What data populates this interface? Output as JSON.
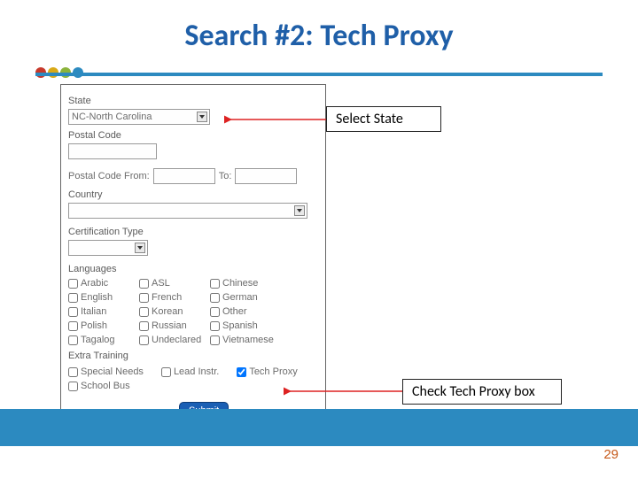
{
  "title": "Search #2: Tech Proxy",
  "dot_colors": [
    "#c7392b",
    "#d9a916",
    "#8bb33b",
    "#2c8ac0"
  ],
  "page_number": "29",
  "callouts": {
    "select_state": "Select State",
    "check_tech_proxy": "Check Tech Proxy box"
  },
  "form": {
    "state": {
      "label": "State",
      "value": "NC-North Carolina"
    },
    "postal_code": {
      "label": "Postal Code",
      "value": ""
    },
    "postal_range": {
      "from_label": "Postal Code From:",
      "to_label": "To:"
    },
    "country": {
      "label": "Country",
      "value": ""
    },
    "cert_type": {
      "label": "Certification Type",
      "value": ""
    },
    "languages": {
      "label": "Languages",
      "options": [
        "Arabic",
        "ASL",
        "Chinese",
        "English",
        "French",
        "German",
        "Italian",
        "Korean",
        "Other",
        "Polish",
        "Russian",
        "Spanish",
        "Tagalog",
        "Undeclared",
        "Vietnamese"
      ]
    },
    "extra_training": {
      "label": "Extra Training",
      "special_needs": {
        "label": "Special Needs",
        "checked": false
      },
      "lead_instr": {
        "label": "Lead Instr.",
        "checked": false
      },
      "tech_proxy": {
        "label": "Tech Proxy",
        "checked": true
      },
      "school_bus": {
        "label": "School Bus",
        "checked": false
      }
    },
    "submit_label": "Submit"
  }
}
